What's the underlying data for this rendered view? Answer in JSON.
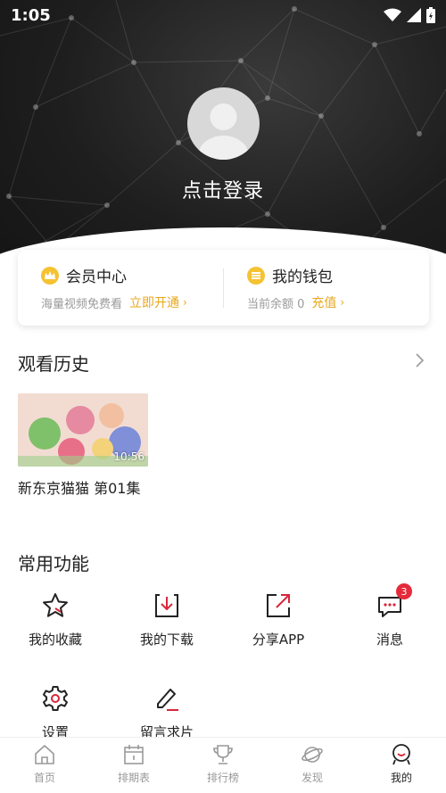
{
  "status_bar": {
    "time": "1:05"
  },
  "profile": {
    "login_text": "点击登录"
  },
  "vip": {
    "title": "会员中心",
    "subtitle": "海量视频免费看",
    "action": "立即开通"
  },
  "wallet": {
    "title": "我的钱包",
    "subtitle": "当前余额 0",
    "action": "充值"
  },
  "history": {
    "title": "观看历史",
    "items": [
      {
        "title": "新东京猫猫 第01集",
        "duration": "10:56"
      }
    ]
  },
  "features": {
    "title": "常用功能",
    "items": [
      {
        "label": "我的收藏",
        "icon": "star-icon"
      },
      {
        "label": "我的下载",
        "icon": "download-icon"
      },
      {
        "label": "分享APP",
        "icon": "share-icon"
      },
      {
        "label": "消息",
        "icon": "message-icon",
        "badge": "3"
      },
      {
        "label": "设置",
        "icon": "gear-icon"
      },
      {
        "label": "留言求片",
        "icon": "edit-icon"
      }
    ]
  },
  "tabbar": {
    "items": [
      {
        "label": "首页",
        "icon": "home-icon"
      },
      {
        "label": "排期表",
        "icon": "calendar-icon"
      },
      {
        "label": "排行榜",
        "icon": "trophy-icon"
      },
      {
        "label": "发现",
        "icon": "planet-icon"
      },
      {
        "label": "我的",
        "icon": "user-face-icon",
        "active": true
      }
    ]
  },
  "colors": {
    "accent": "#e8a71c",
    "badge": "#e52a3a",
    "icon_red": "#d8263a",
    "header_dark": "#1e1e1e"
  }
}
